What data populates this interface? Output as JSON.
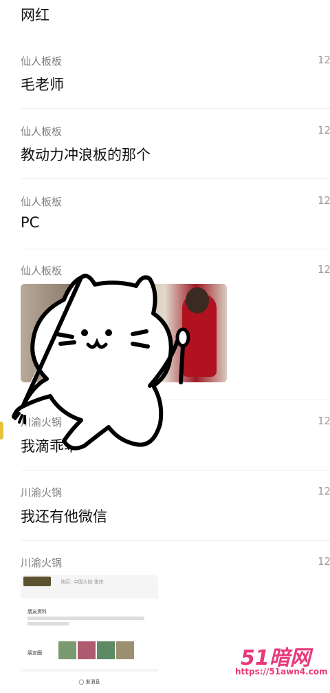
{
  "top_message": "网红",
  "messages": [
    {
      "sender": "仙人板板",
      "time": "12",
      "text": "毛老师"
    },
    {
      "sender": "仙人板板",
      "time": "12",
      "text": "教动力冲浪板的那个"
    },
    {
      "sender": "仙人板板",
      "time": "12",
      "text": "PC"
    },
    {
      "sender": "仙人板板",
      "time": "12",
      "image": "photo"
    },
    {
      "sender": "川渝火锅",
      "time": "12",
      "text": "我滴乖乖"
    },
    {
      "sender": "川渝火锅",
      "time": "12",
      "text": "我还有他微信"
    },
    {
      "sender": "川渝火锅",
      "time": "12",
      "image": "profile-card"
    }
  ],
  "profile_card": {
    "location": "地区: 中国大陆 重庆",
    "section_1_label": "朋友资料",
    "section_2_label": "朋友圈",
    "send_label": "发消息"
  },
  "watermark": {
    "logo": "51暗网",
    "url": "https://51awn4.com"
  },
  "colors": {
    "watermark": "#e8397a",
    "sender_text": "#7c7c7c",
    "separator": "#eeeeee"
  }
}
